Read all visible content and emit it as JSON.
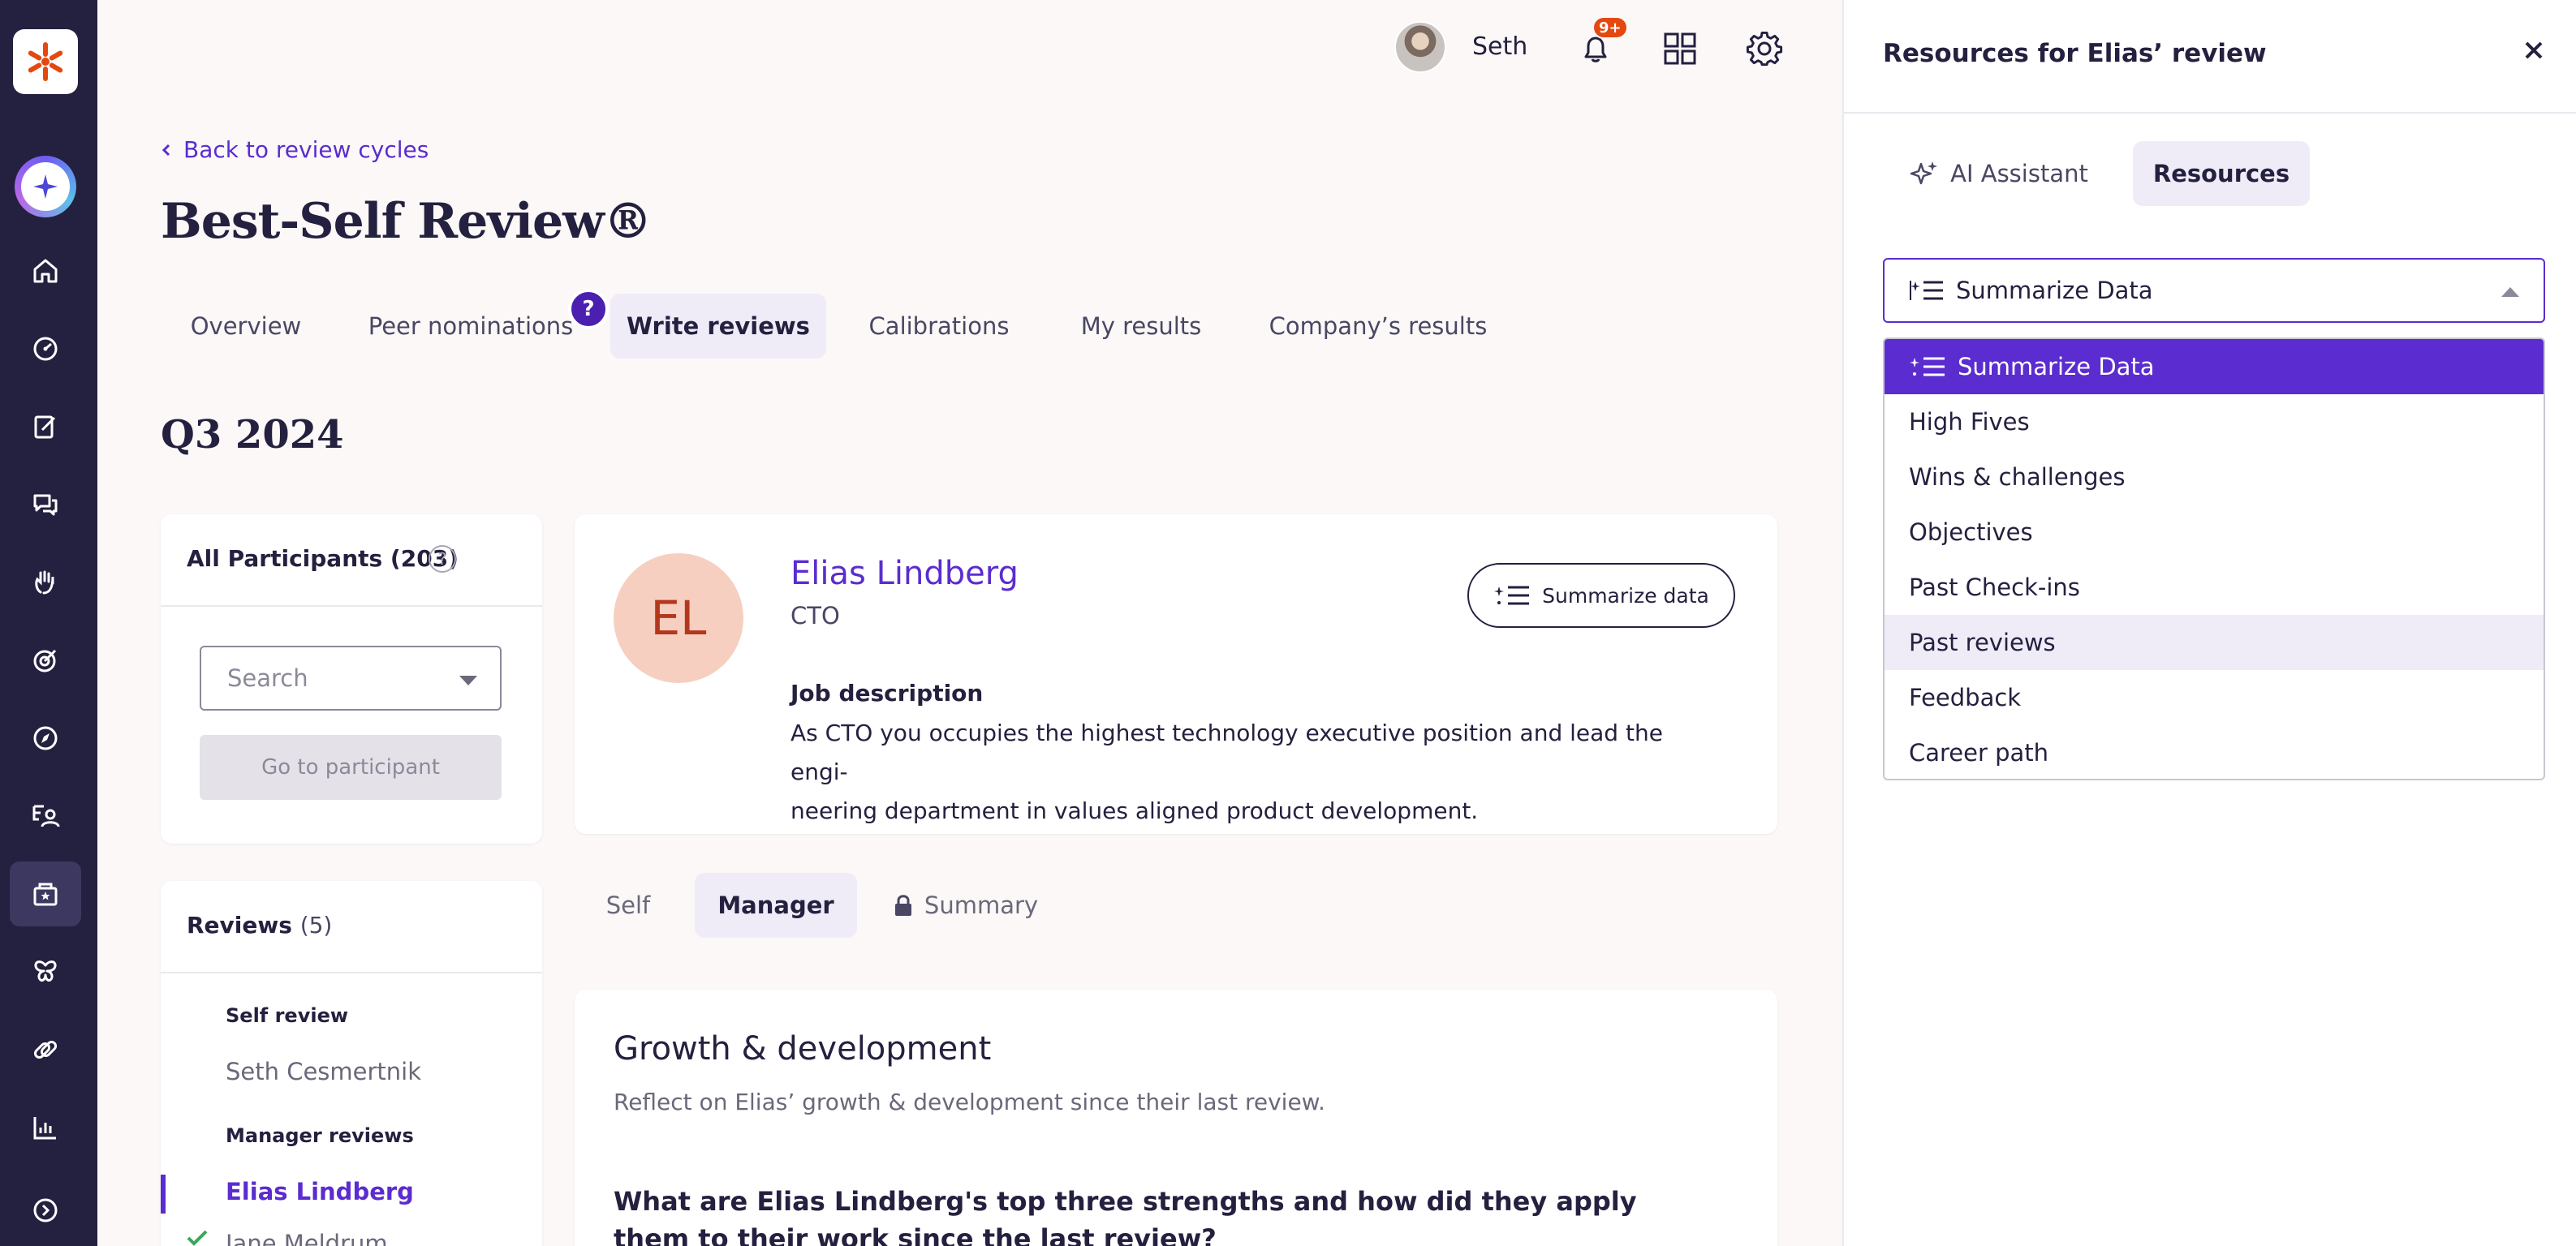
{
  "header": {
    "user_name": "Seth",
    "notifications_badge": "9+"
  },
  "page": {
    "back_link": "Back to review cycles",
    "title": "Best-Self Review®",
    "tabs": [
      {
        "label": "Overview"
      },
      {
        "label": "Peer nominations"
      },
      {
        "label": "Write reviews",
        "active": true
      },
      {
        "label": "Calibrations"
      },
      {
        "label": "My results"
      },
      {
        "label": "Company’s results"
      }
    ],
    "help_glyph": "?",
    "period": "Q3 2024"
  },
  "participants": {
    "title": "All Participants (203)",
    "help_glyph": "?",
    "search_placeholder": "Search",
    "goto_label": "Go to participant"
  },
  "reviews_list": {
    "title": "Reviews",
    "count": "(5)",
    "self_group": "Self review",
    "self_reviewer": "Seth Cesmertnik",
    "manager_group": "Manager reviews",
    "manager_reviewers": [
      "Elias Lindberg",
      "Jane Meldrum"
    ]
  },
  "person": {
    "initials": "EL",
    "name": "Elias Lindberg",
    "role": "CTO",
    "summarize_button": "Summarize data",
    "job_label": "Job description",
    "job_text_line1": "As CTO you occupies the highest technology executive position and lead the engi-",
    "job_text_line2": "neering department in values aligned product development."
  },
  "review_tabs": [
    {
      "label": "Self"
    },
    {
      "label": "Manager",
      "active": true
    },
    {
      "label": "Summary",
      "locked": true
    }
  ],
  "growth": {
    "title": "Growth & development",
    "subtitle": "Reflect on Elias’ growth & development since their last review.",
    "question": "What are Elias Lindberg's top three strengths and how did they apply them to their work since the last review?"
  },
  "panel": {
    "title": "Resources for Elias’ review",
    "tabs": [
      {
        "label": "AI Assistant"
      },
      {
        "label": "Resources",
        "active": true
      }
    ],
    "select_value": "Summarize Data",
    "options": [
      {
        "label": "Summarize Data",
        "selected": true
      },
      {
        "label": "High Fives"
      },
      {
        "label": "Wins & challenges"
      },
      {
        "label": "Objectives"
      },
      {
        "label": "Past Check-ins"
      },
      {
        "label": "Past reviews",
        "hover": true
      },
      {
        "label": "Feedback"
      },
      {
        "label": "Career path"
      }
    ]
  },
  "colors": {
    "rail": "#24203f",
    "accent": "#5b2ccf",
    "tab_active_bg": "#efecf8",
    "avatar_bg": "#f6cfc0",
    "badge": "#e4480f"
  },
  "icons": {
    "rail": [
      "home-icon",
      "performance-icon",
      "reviews-edit-icon",
      "chat-icon",
      "high-five-icon",
      "target-icon",
      "compass-icon",
      "people-icon",
      "review-cycles-icon",
      "butterfly-icon",
      "integrations-icon",
      "analytics-icon",
      "expand-icon"
    ]
  }
}
